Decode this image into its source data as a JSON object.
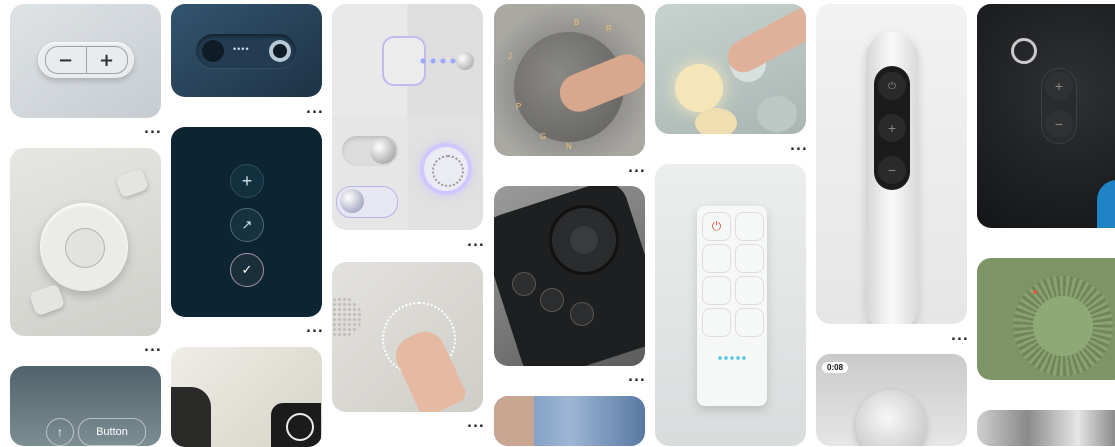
{
  "feed": {
    "more_label": "...",
    "badges": {
      "video_duration": "0:08"
    },
    "pins": [
      {
        "id": "pin-stepper",
        "title_icons": [
          "minus-icon",
          "plus-icon"
        ],
        "labels": {
          "minus": "−",
          "plus": "+"
        }
      },
      {
        "id": "pin-dark-slider",
        "labels": {
          "dots": "••••"
        }
      },
      {
        "id": "pin-neumorphic-toggles"
      },
      {
        "id": "pin-hand-dial",
        "letters": [
          "J",
          "B",
          "P",
          "R",
          "G",
          "N"
        ]
      },
      {
        "id": "pin-finger-touch-lights"
      },
      {
        "id": "pin-remote-long",
        "labels": {
          "plus": "+",
          "minus": "−"
        }
      },
      {
        "id": "pin-speaker-dark",
        "labels": {
          "plus": "+",
          "minus": "−"
        }
      },
      {
        "id": "pin-remote-dial-white"
      },
      {
        "id": "pin-dark-vertical-buttons",
        "labels": {
          "plus": "+",
          "arrow": "↗",
          "check": "✓"
        }
      },
      {
        "id": "pin-dark-remote"
      },
      {
        "id": "pin-wall-panel"
      },
      {
        "id": "pin-hand-panel-lights"
      },
      {
        "id": "pin-green-knob"
      },
      {
        "id": "pin-button-chip",
        "labels": {
          "button": "Button",
          "up": "↑"
        }
      },
      {
        "id": "pin-textured-device"
      },
      {
        "id": "pin-video-knob"
      },
      {
        "id": "pin-denim"
      },
      {
        "id": "pin-metal"
      }
    ]
  },
  "colors": {
    "accent_red": "#e0584a",
    "panel_blue": "#2c4a66",
    "dark_navy": "#0d2533",
    "green": "#7d9466",
    "glow_yellow": "#f4e6b8"
  }
}
